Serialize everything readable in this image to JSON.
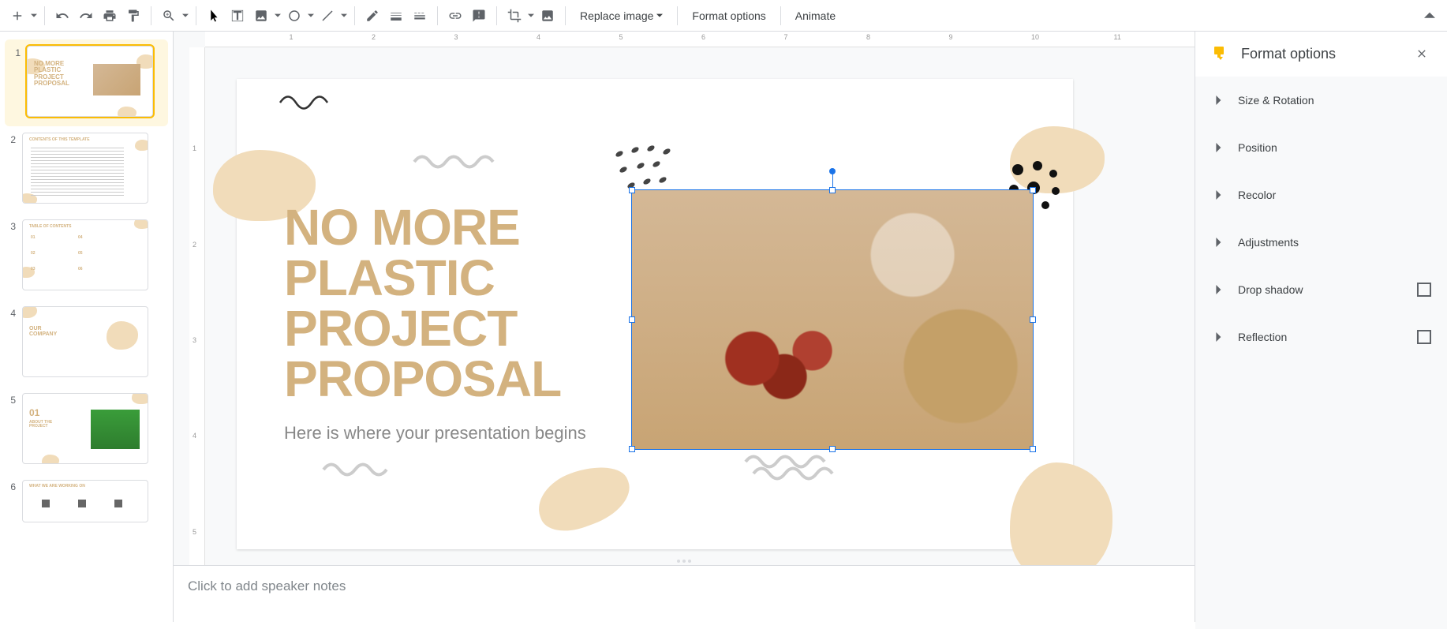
{
  "toolbar": {
    "replace_image": "Replace image",
    "format_options": "Format options",
    "animate": "Animate"
  },
  "filmstrip": {
    "slides": [
      {
        "num": "1",
        "title": "NO MORE\nPLASTIC\nPROJECT\nPROPOSAL",
        "selected": true
      },
      {
        "num": "2",
        "title": "CONTENTS OF THIS TEMPLATE"
      },
      {
        "num": "3",
        "title": "TABLE OF CONTENTS"
      },
      {
        "num": "4",
        "title": "OUR\nCOMPANY"
      },
      {
        "num": "5",
        "title": "01",
        "sub": "ABOUT THE\nPROJECT"
      },
      {
        "num": "6",
        "title": "WHAT WE ARE WORKING ON"
      }
    ]
  },
  "slide": {
    "title_line1": "NO MORE",
    "title_line2": "PLASTIC",
    "title_line3": "PROJECT",
    "title_line4": "PROPOSAL",
    "subtitle": "Here is where your presentation begins"
  },
  "ruler_h": [
    "",
    "1",
    "2",
    "3",
    "4",
    "5",
    "6",
    "7",
    "8",
    "9",
    "10",
    "11"
  ],
  "ruler_v": [
    "",
    "1",
    "2",
    "3",
    "4",
    "5"
  ],
  "notes": {
    "placeholder": "Click to add speaker notes"
  },
  "format_panel": {
    "title": "Format options",
    "sections": [
      {
        "label": "Size & Rotation",
        "checkbox": false
      },
      {
        "label": "Position",
        "checkbox": false
      },
      {
        "label": "Recolor",
        "checkbox": false
      },
      {
        "label": "Adjustments",
        "checkbox": false
      },
      {
        "label": "Drop shadow",
        "checkbox": true
      },
      {
        "label": "Reflection",
        "checkbox": true
      }
    ]
  }
}
